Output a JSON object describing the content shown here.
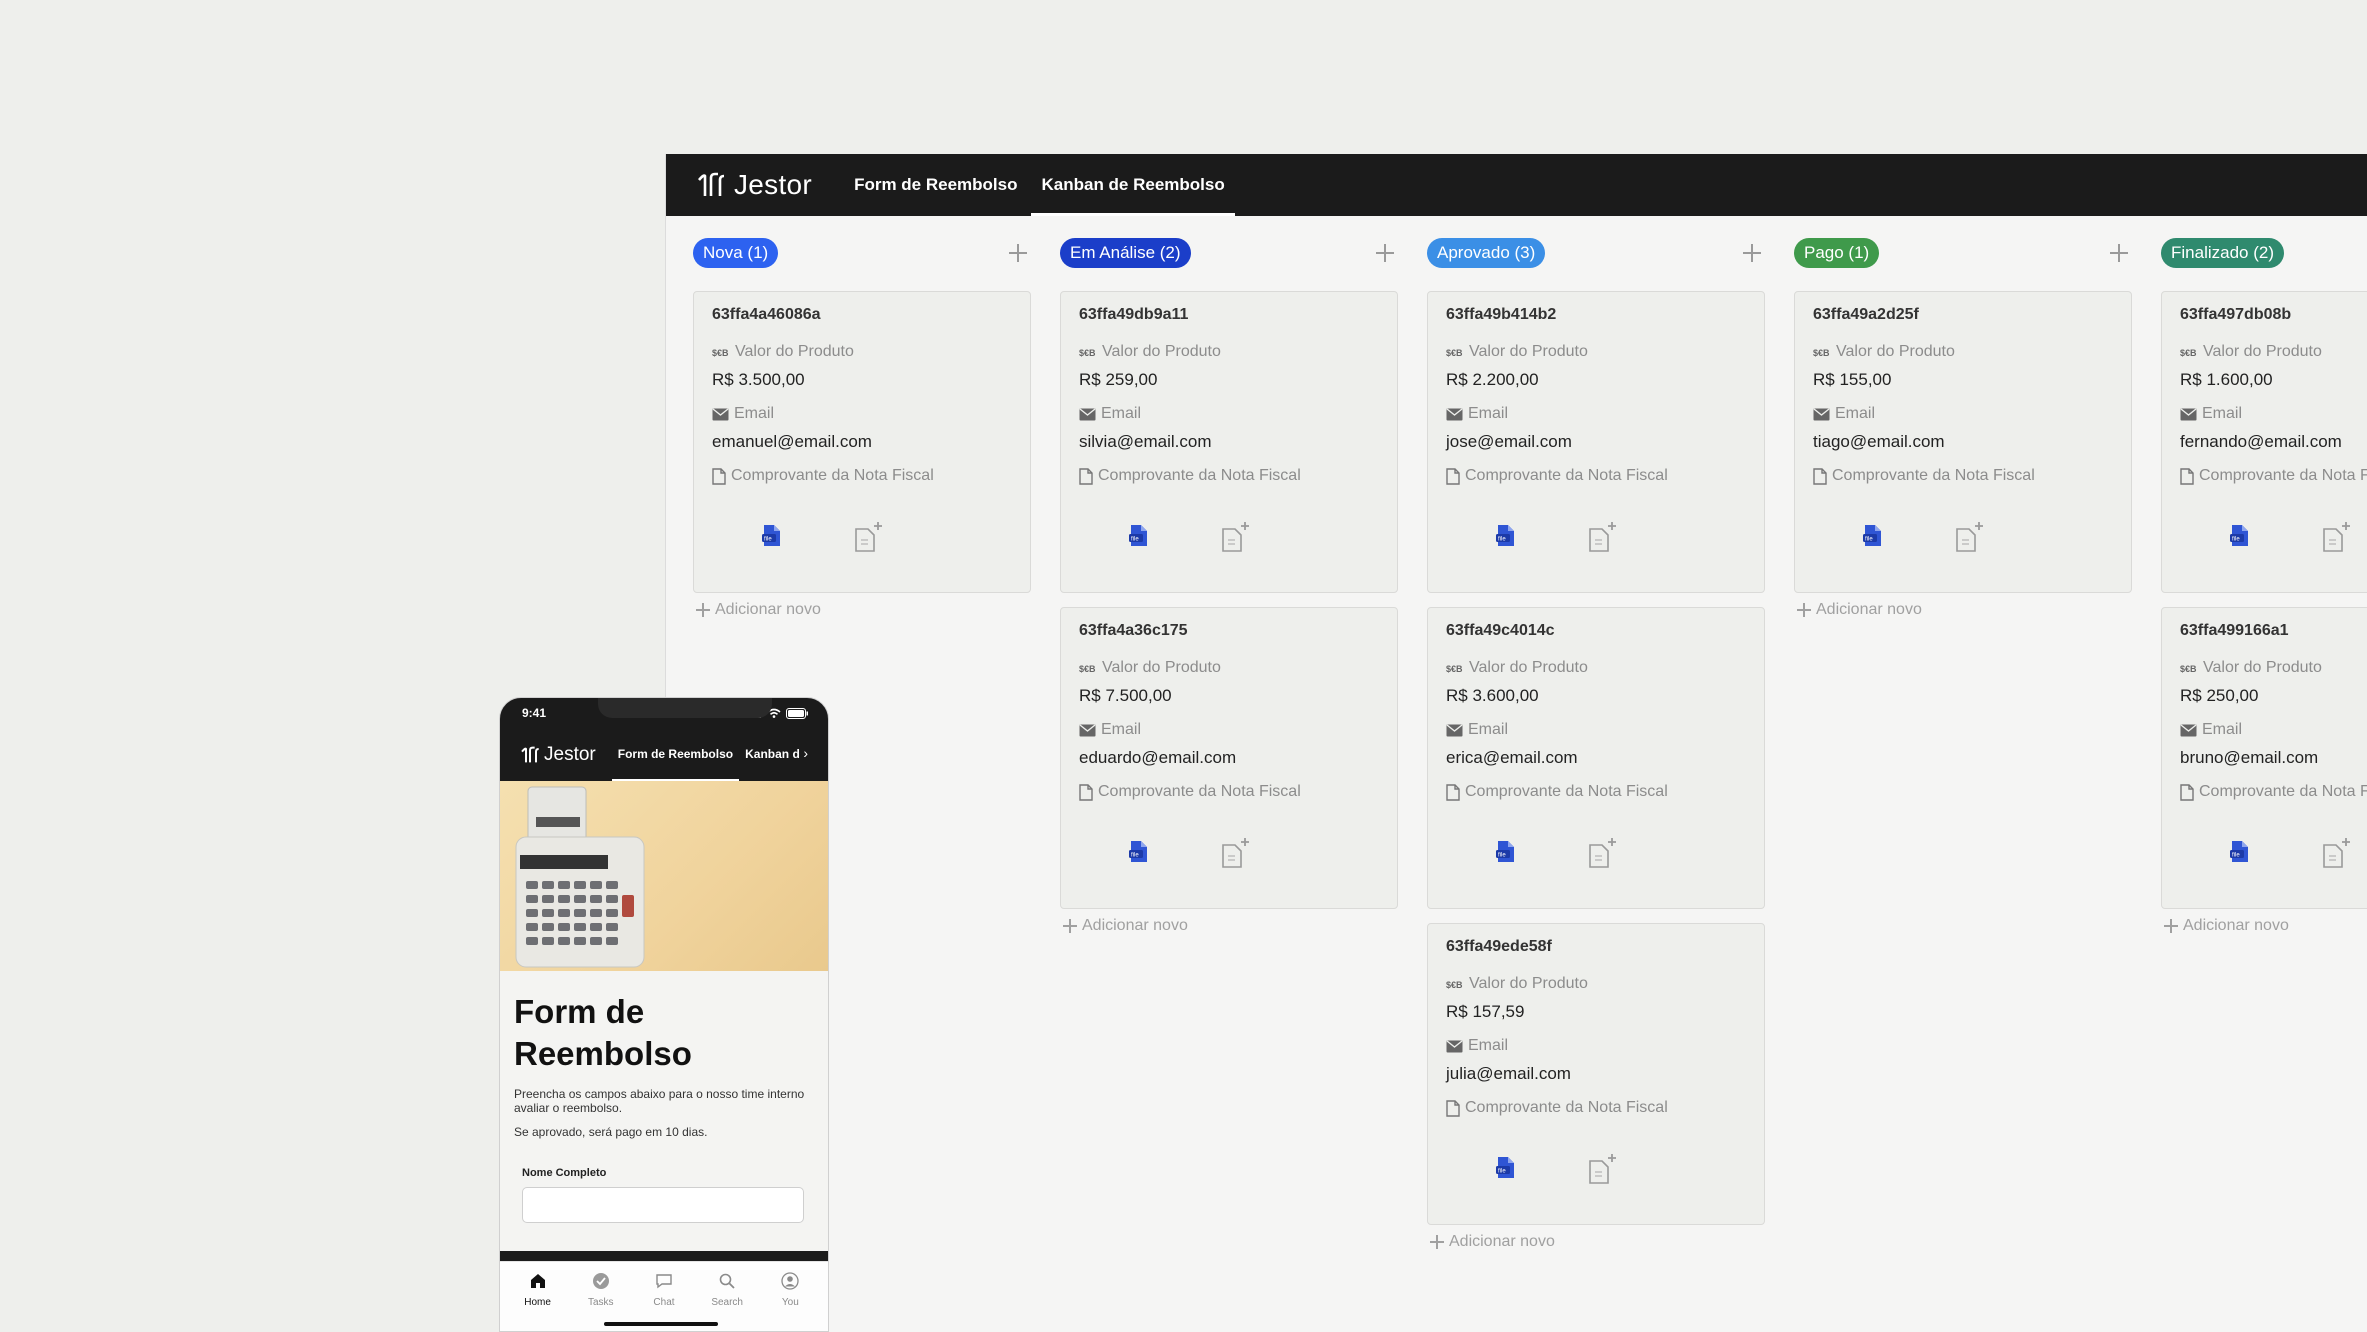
{
  "app": {
    "brand": "Jestor"
  },
  "desktop": {
    "tabs": [
      {
        "label": "Form de Reembolso",
        "active": false
      },
      {
        "label": "Kanban de Reembolso",
        "active": true
      }
    ]
  },
  "field_labels": {
    "valor": "Valor do Produto",
    "email": "Email",
    "comprovante": "Comprovante da Nota Fiscal"
  },
  "add_new_label": "Adicionar novo",
  "columns": [
    {
      "title": "Nova (1)",
      "color": "#2d62f0",
      "cards": [
        {
          "id": "63ffa4a46086a",
          "valor": "R$ 3.500,00",
          "email": "emanuel@email.com"
        }
      ]
    },
    {
      "title": "Em Análise (2)",
      "color": "#1b3ec9",
      "cards": [
        {
          "id": "63ffa49db9a11",
          "valor": "R$ 259,00",
          "email": "silvia@email.com"
        },
        {
          "id": "63ffa4a36c175",
          "valor": "R$ 7.500,00",
          "email": "eduardo@email.com"
        }
      ]
    },
    {
      "title": "Aprovado (3)",
      "color": "#3b8fe6",
      "cards": [
        {
          "id": "63ffa49b414b2",
          "valor": "R$ 2.200,00",
          "email": "jose@email.com"
        },
        {
          "id": "63ffa49c4014c",
          "valor": "R$ 3.600,00",
          "email": "erica@email.com"
        },
        {
          "id": "63ffa49ede58f",
          "valor": "R$ 157,59",
          "email": "julia@email.com"
        }
      ]
    },
    {
      "title": "Pago (1)",
      "color": "#3f9a4b",
      "cards": [
        {
          "id": "63ffa49a2d25f",
          "valor": "R$ 155,00",
          "email": "tiago@email.com"
        }
      ]
    },
    {
      "title": "Finalizado (2)",
      "color": "#2f8a6e",
      "cards": [
        {
          "id": "63ffa497db08b",
          "valor": "R$ 1.600,00",
          "email": "fernando@email.com"
        },
        {
          "id": "63ffa499166a1",
          "valor": "R$ 250,00",
          "email": "bruno@email.com"
        }
      ]
    }
  ],
  "phone": {
    "time": "9:41",
    "tabs": [
      {
        "label": "Form de Reembolso",
        "active": true
      },
      {
        "label": "Kanban d",
        "active": false
      }
    ],
    "form_title": "Form de Reembolso",
    "desc1": "Preencha os campos abaixo para o nosso time interno avaliar o reembolso.",
    "desc2": "Se aprovado, será pago em 10 dias.",
    "field_label": "Nome Completo",
    "tabbar": [
      {
        "label": "Home",
        "icon": "home-icon",
        "active": true
      },
      {
        "label": "Tasks",
        "icon": "check-circle-icon",
        "active": false
      },
      {
        "label": "Chat",
        "icon": "chat-icon",
        "active": false
      },
      {
        "label": "Search",
        "icon": "search-icon",
        "active": false
      },
      {
        "label": "You",
        "icon": "user-icon",
        "active": false
      }
    ]
  }
}
